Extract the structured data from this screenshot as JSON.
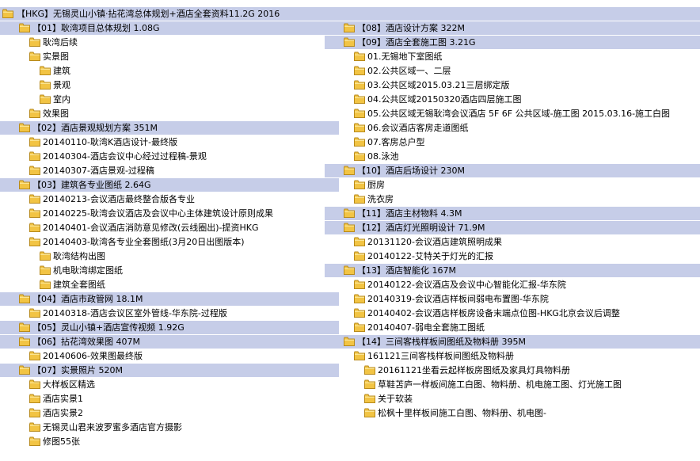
{
  "colors": {
    "header_bg": "#c6cde8",
    "folder_fill": "#f2c444",
    "folder_edge": "#b88a1a"
  },
  "title": "【HKG】无锡灵山小镇·拈花湾总体规划+酒店全套资料11.2G 2016",
  "left": [
    {
      "text": "【01】耿湾项目总体规划 1.08G",
      "level": 0,
      "header": true
    },
    {
      "text": "耿湾后续",
      "level": 1
    },
    {
      "text": "实景图",
      "level": 1
    },
    {
      "text": "建筑",
      "level": 2
    },
    {
      "text": "景观",
      "level": 2
    },
    {
      "text": "室内",
      "level": 2
    },
    {
      "text": "效果图",
      "level": 1
    },
    {
      "text": "【02】酒店景观规划方案 351M",
      "level": 0,
      "header": true
    },
    {
      "text": "20140110-耿湾K酒店设计-最终版",
      "level": 1
    },
    {
      "text": "20140304-酒店会议中心经过过程稿-景观",
      "level": 1
    },
    {
      "text": "20140307-酒店景观-过程稿",
      "level": 1
    },
    {
      "text": "【03】建筑各专业图纸 2.64G",
      "level": 0,
      "header": true
    },
    {
      "text": "20140213-会议酒店最终整合版各专业",
      "level": 1
    },
    {
      "text": "20140225-耿湾会议酒店及会议中心主体建筑设计原则成果",
      "level": 1
    },
    {
      "text": "20140401-会议酒店消防意见修改(云线圈出)-提资HKG",
      "level": 1
    },
    {
      "text": "20140403-耿湾各专业全套图纸(3月20日出图版本)",
      "level": 1
    },
    {
      "text": "耿湾结构出图",
      "level": 2
    },
    {
      "text": "机电耿湾绑定图纸",
      "level": 2
    },
    {
      "text": "建筑全套图纸",
      "level": 2
    },
    {
      "text": "【04】酒店市政管网 18.1M",
      "level": 0,
      "header": true
    },
    {
      "text": "20140318-酒店会议区室外管线-华东院-过程版",
      "level": 1
    },
    {
      "text": "【05】灵山小镇+酒店宣传视频 1.92G",
      "level": 0,
      "header": true
    },
    {
      "text": "【06】拈花湾效果图 407M",
      "level": 0,
      "header": true
    },
    {
      "text": "20140606-效果图最终版",
      "level": 1
    },
    {
      "text": "【07】实景照片 520M",
      "level": 0,
      "header": true
    },
    {
      "text": "大样板区精选",
      "level": 1
    },
    {
      "text": "酒店实景1",
      "level": 1
    },
    {
      "text": "酒店实景2",
      "level": 1
    },
    {
      "text": "无锡灵山君来波罗蜜多酒店官方摄影",
      "level": 1
    },
    {
      "text": "修图55张",
      "level": 1
    }
  ],
  "right": [
    {
      "text": "【08】酒店设计方案 322M",
      "level": 0,
      "header": true
    },
    {
      "text": "【09】酒店全套施工图 3.21G",
      "level": 0,
      "header": true
    },
    {
      "text": "01.无锡地下室图纸",
      "level": 1
    },
    {
      "text": "02.公共区域一、二层",
      "level": 1
    },
    {
      "text": "03.公共区域2015.03.21三层绑定版",
      "level": 1
    },
    {
      "text": "04.公共区域20150320酒店四层施工图",
      "level": 1
    },
    {
      "text": "05.公共区域无锡耿湾会议酒店 5F 6F 公共区域-施工图 2015.03.16-施工白图",
      "level": 1
    },
    {
      "text": "06.会议酒店客房走道图纸",
      "level": 1
    },
    {
      "text": "07.客房总户型",
      "level": 1
    },
    {
      "text": "08.泳池",
      "level": 1
    },
    {
      "text": "【10】酒店后场设计 230M",
      "level": 0,
      "header": true
    },
    {
      "text": "厨房",
      "level": 1
    },
    {
      "text": "洗衣房",
      "level": 1
    },
    {
      "text": "【11】酒店主材物料 4.3M",
      "level": 0,
      "header": true
    },
    {
      "text": "【12】酒店灯光照明设计 71.9M",
      "level": 0,
      "header": true
    },
    {
      "text": "20131120-会议酒店建筑照明成果",
      "level": 1
    },
    {
      "text": "20140122-艾特关于灯光的汇报",
      "level": 1
    },
    {
      "text": "【13】酒店智能化 167M",
      "level": 0,
      "header": true
    },
    {
      "text": "20140122-会议酒店及会议中心智能化汇报-华东院",
      "level": 1
    },
    {
      "text": "20140319-会议酒店样板间弱电布置图-华东院",
      "level": 1
    },
    {
      "text": "20140402-会议酒店样板房设备末端点位图-HKG北京会议后调整",
      "level": 1
    },
    {
      "text": "20140407-弱电全套施工图纸",
      "level": 1
    },
    {
      "text": "【14】三间客栈样板间图纸及物料册 395M",
      "level": 0,
      "header": true
    },
    {
      "text": "161121三间客栈样板间图纸及物料册",
      "level": 1
    },
    {
      "text": "20161121坐看云起样板房图纸及家具灯具物料册",
      "level": 2
    },
    {
      "text": "草鞋苫庐一样板间施工白图、物料册、机电施工图、灯光施工图",
      "level": 2
    },
    {
      "text": "关于软装",
      "level": 2
    },
    {
      "text": "松枫十里样板间施工白图、物料册、机电图-",
      "level": 2
    }
  ]
}
